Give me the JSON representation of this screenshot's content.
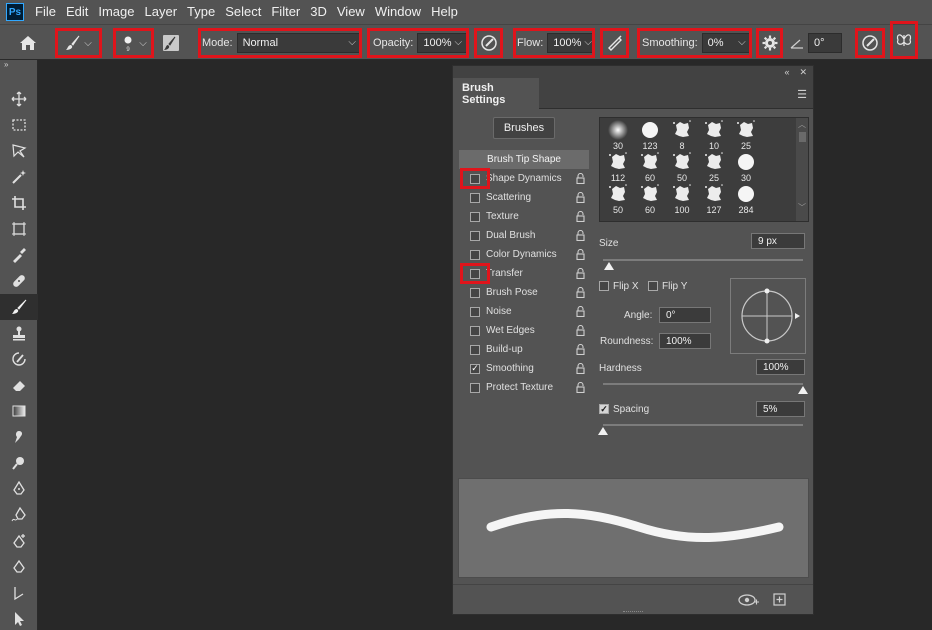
{
  "menubar": {
    "logo": "Ps",
    "items": [
      "File",
      "Edit",
      "Image",
      "Layer",
      "Type",
      "Select",
      "Filter",
      "3D",
      "View",
      "Window",
      "Help"
    ]
  },
  "options_bar": {
    "mode_label": "Mode:",
    "mode_value": "Normal",
    "opacity_label": "Opacity:",
    "opacity_value": "100%",
    "flow_label": "Flow:",
    "flow_value": "100%",
    "smoothing_label": "Smoothing:",
    "smoothing_value": "0%",
    "angle_value": "0°"
  },
  "toolbar": {
    "tools": [
      "move-tool",
      "marquee-tool",
      "lasso-tool",
      "magic-wand-tool",
      "crop-tool",
      "frame-tool",
      "eyedropper-tool",
      "healing-brush-tool",
      "brush-tool",
      "clone-stamp-tool",
      "history-brush-tool",
      "eraser-tool",
      "gradient-tool",
      "smudge-tool",
      "dodge-tool",
      "pen-tool",
      "freeform-pen-tool",
      "add-anchor-point-tool",
      "convert-point-tool",
      "path-selection-tool",
      "direct-selection-tool"
    ]
  },
  "brush_panel": {
    "tab_label": "Brush Settings",
    "brushes_button": "Brushes",
    "header_item": "Brush Tip Shape",
    "options": [
      {
        "label": "Shape Dynamics",
        "checked": false
      },
      {
        "label": "Scattering",
        "checked": false
      },
      {
        "label": "Texture",
        "checked": false
      },
      {
        "label": "Dual Brush",
        "checked": false
      },
      {
        "label": "Color Dynamics",
        "checked": false
      },
      {
        "label": "Transfer",
        "checked": false
      },
      {
        "label": "Brush Pose",
        "checked": false
      },
      {
        "label": "Noise",
        "checked": false
      },
      {
        "label": "Wet Edges",
        "checked": false
      },
      {
        "label": "Build-up",
        "checked": false
      },
      {
        "label": "Smoothing",
        "checked": true
      },
      {
        "label": "Protect Texture",
        "checked": false
      }
    ],
    "presets": [
      "30",
      "123",
      "8",
      "10",
      "25",
      "112",
      "60",
      "50",
      "25",
      "30",
      "50",
      "60",
      "100",
      "127",
      "284"
    ],
    "size_label": "Size",
    "size_value": "9 px",
    "size_level": 0.03,
    "flip_x_label": "Flip X",
    "flip_y_label": "Flip Y",
    "angle_label": "Angle:",
    "angle_value": "0°",
    "roundness_label": "Roundness:",
    "roundness_value": "100%",
    "hardness_label": "Hardness",
    "hardness_value": "100%",
    "hardness_level": 1.0,
    "spacing_label": "Spacing",
    "spacing_value": "5%",
    "spacing_checked": true,
    "spacing_level": 0.0,
    "check_mark": "✓"
  }
}
